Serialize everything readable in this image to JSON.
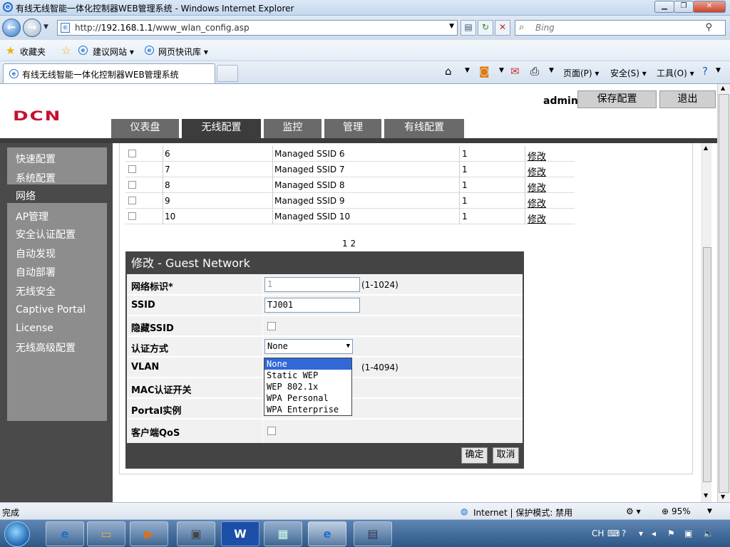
{
  "browser": {
    "window_title": "有线无线智能一体化控制器WEB管理系统 - Windows Internet Explorer",
    "url_prefix": "http://",
    "url_host": "192.168.1.1",
    "url_path": "/www_wlan_config.asp",
    "search_placeholder": "Bing",
    "tab_title": "有线无线智能一体化控制器WEB管理系统",
    "favorites_label": "收藏夹",
    "suggested_sites": "建议网站 ▾",
    "web_slice": "网页快讯库 ▾",
    "cmd_page": "页面(P) ▾",
    "cmd_safety": "安全(S) ▾",
    "cmd_tools": "工具(O) ▾"
  },
  "header": {
    "logo": "DCN",
    "user": "admin",
    "save_label": "保存配置",
    "exit_label": "退出"
  },
  "main_tabs": [
    {
      "label": "仪表盘"
    },
    {
      "label": "无线配置"
    },
    {
      "label": "监控"
    },
    {
      "label": "管理"
    },
    {
      "label": "有线配置"
    }
  ],
  "sidebar": {
    "items": [
      {
        "label": "快速配置"
      },
      {
        "label": "系统配置"
      },
      {
        "label": "网络"
      },
      {
        "label": "AP管理"
      },
      {
        "label": "安全认证配置"
      },
      {
        "label": "自动发现"
      },
      {
        "label": "自动部署"
      },
      {
        "label": "无线安全"
      },
      {
        "label": "Captive Portal"
      },
      {
        "label": "License"
      },
      {
        "label": "无线高级配置"
      }
    ]
  },
  "ssid_table": {
    "rows": [
      {
        "id": "6",
        "name": "Managed SSID 6",
        "value": "1",
        "action": "修改"
      },
      {
        "id": "7",
        "name": "Managed SSID 7",
        "value": "1",
        "action": "修改"
      },
      {
        "id": "8",
        "name": "Managed SSID 8",
        "value": "1",
        "action": "修改"
      },
      {
        "id": "9",
        "name": "Managed SSID 9",
        "value": "1",
        "action": "修改"
      },
      {
        "id": "10",
        "name": "Managed SSID 10",
        "value": "1",
        "action": "修改"
      }
    ],
    "pager": "1 2"
  },
  "modal": {
    "title": "修改  - Guest Network",
    "fields": {
      "network_id_label": "网络标识*",
      "network_id_value": "1",
      "network_id_hint": "(1-1024)",
      "ssid_label": "SSID",
      "ssid_value": "TJ001",
      "hide_ssid_label": "隐藏SSID",
      "auth_label": "认证方式",
      "auth_value": "None",
      "vlan_label": "VLAN",
      "vlan_hint": "(1-4094)",
      "mac_auth_label": "MAC认证开关",
      "portal_label": "Portal实例",
      "qos_label": "客户端QoS"
    },
    "ok_label": "确定",
    "cancel_label": "取消"
  },
  "auth_options": [
    "None",
    "Static WEP",
    "WEP 802.1x",
    "WPA Personal",
    "WPA Enterprise"
  ],
  "statusbar": {
    "left": "完成",
    "zone": "Internet | 保护模式: 禁用",
    "zoom": "95%"
  },
  "tray": {
    "lang": "CH"
  },
  "colors": {
    "logo_red": "#c8102e",
    "sidebar_dark": "#4a4a4a",
    "sidebar_panel": "#8d8d8d",
    "selected_option": "#3168d5"
  }
}
